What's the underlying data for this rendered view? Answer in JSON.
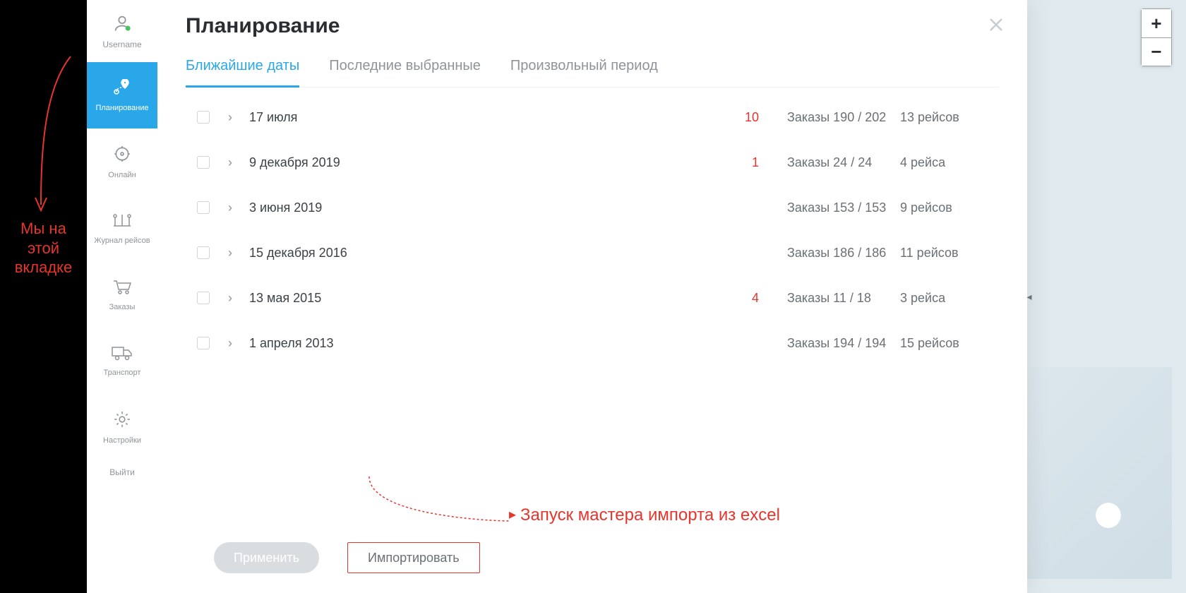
{
  "colors": {
    "accent": "#29a7e8",
    "danger": "#e5352d"
  },
  "annotations": {
    "left_note": "Мы на\nэтой\nвкладке",
    "import_note": "Запуск мастера импорта из excel"
  },
  "user": {
    "name": "Username"
  },
  "sidebar": {
    "items": [
      {
        "id": "planning",
        "label": "Планирование",
        "active": true
      },
      {
        "id": "online",
        "label": "Онлайн",
        "active": false
      },
      {
        "id": "journal",
        "label": "Журнал рейсов",
        "active": false
      },
      {
        "id": "orders",
        "label": "Заказы",
        "active": false
      },
      {
        "id": "transport",
        "label": "Транспорт",
        "active": false
      },
      {
        "id": "settings",
        "label": "Настройки",
        "active": false
      }
    ],
    "logout": "Выйти"
  },
  "modal": {
    "title": "Планирование",
    "tabs": [
      {
        "label": "Ближайшие даты",
        "active": true
      },
      {
        "label": "Последние выбранные",
        "active": false
      },
      {
        "label": "Произвольный период",
        "active": false
      }
    ],
    "orders_prefix": "Заказы",
    "rows": [
      {
        "date": "17 июля",
        "warn": "10",
        "orders": "190 / 202",
        "trips": "13 рейсов"
      },
      {
        "date": "9 декабря 2019",
        "warn": "1",
        "orders": "24 / 24",
        "trips": "4 рейса"
      },
      {
        "date": "3 июня 2019",
        "warn": "",
        "orders": "153 / 153",
        "trips": "9 рейсов"
      },
      {
        "date": "15 декабря 2016",
        "warn": "",
        "orders": "186 / 186",
        "trips": "11 рейсов"
      },
      {
        "date": "13 мая 2015",
        "warn": "4",
        "orders": "11 / 18",
        "trips": "3 рейса"
      },
      {
        "date": "1 апреля 2013",
        "warn": "",
        "orders": "194 / 194",
        "trips": "15 рейсов"
      }
    ],
    "actions": {
      "apply": "Применить",
      "import": "Импортировать"
    }
  },
  "zoom": {
    "in": "+",
    "out": "−"
  }
}
